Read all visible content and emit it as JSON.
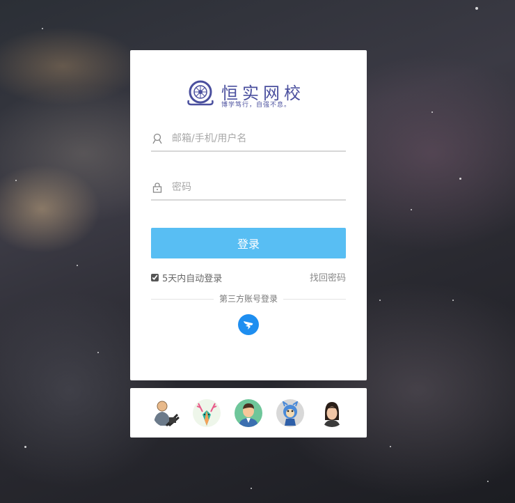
{
  "logo": {
    "title": "恒实网校",
    "slogan": "博学笃行，自强不息。",
    "brand_color": "#4a4f9e"
  },
  "form": {
    "username_placeholder": "邮箱/手机/用户名",
    "password_placeholder": "密码",
    "username_icon": "user-icon",
    "password_icon": "lock-icon",
    "login_label": "登录",
    "login_color": "#58bef3",
    "remember_label": "5天内自动登录",
    "remember_checked": true,
    "forgot_label": "找回密码"
  },
  "third_party": {
    "label": "第三方账号登录",
    "icon": "dingtalk-icon",
    "icon_color": "#1e8ef0"
  },
  "avatars": [
    {
      "name": "user-computer-avatar"
    },
    {
      "name": "deer-avatar"
    },
    {
      "name": "man-avatar"
    },
    {
      "name": "cartoon-avatar"
    },
    {
      "name": "woman-avatar"
    }
  ]
}
